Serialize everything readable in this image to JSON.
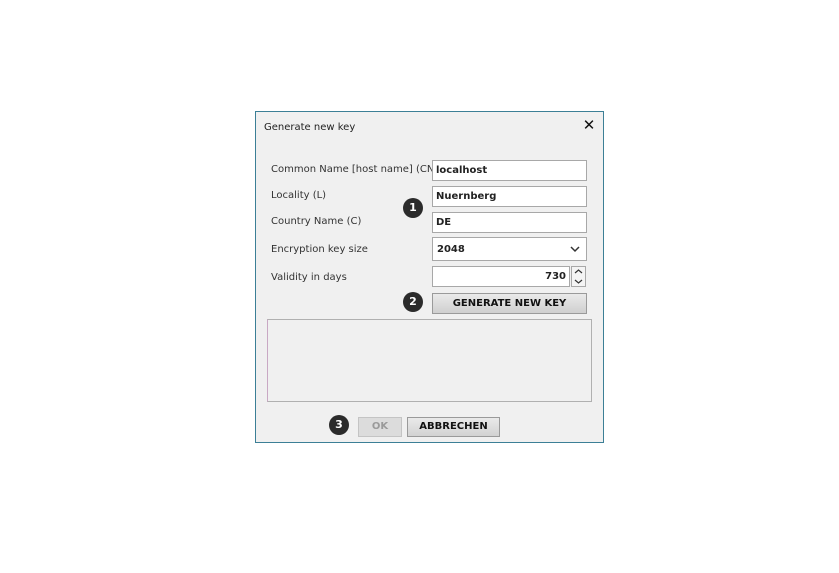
{
  "dialog": {
    "title": "Generate new key",
    "close_icon": "close-icon"
  },
  "form": {
    "common_name": {
      "label": "Common Name [host name] (CN)",
      "value": "localhost"
    },
    "locality": {
      "label": "Locality (L)",
      "value": "Nuernberg"
    },
    "country": {
      "label": "Country Name (C)",
      "value": "DE"
    },
    "key_size": {
      "label": "Encryption key size",
      "value": "2048",
      "icon": "chevron-down-icon"
    },
    "validity": {
      "label": "Validity in days",
      "value": "730"
    }
  },
  "buttons": {
    "generate": "GENERATE NEW KEY",
    "ok": "OK",
    "cancel": "ABBRECHEN"
  },
  "markers": [
    "1",
    "2",
    "3"
  ],
  "colors": {
    "dialog_border": "#3c7f96",
    "marker_bg": "#2b2b2b"
  }
}
